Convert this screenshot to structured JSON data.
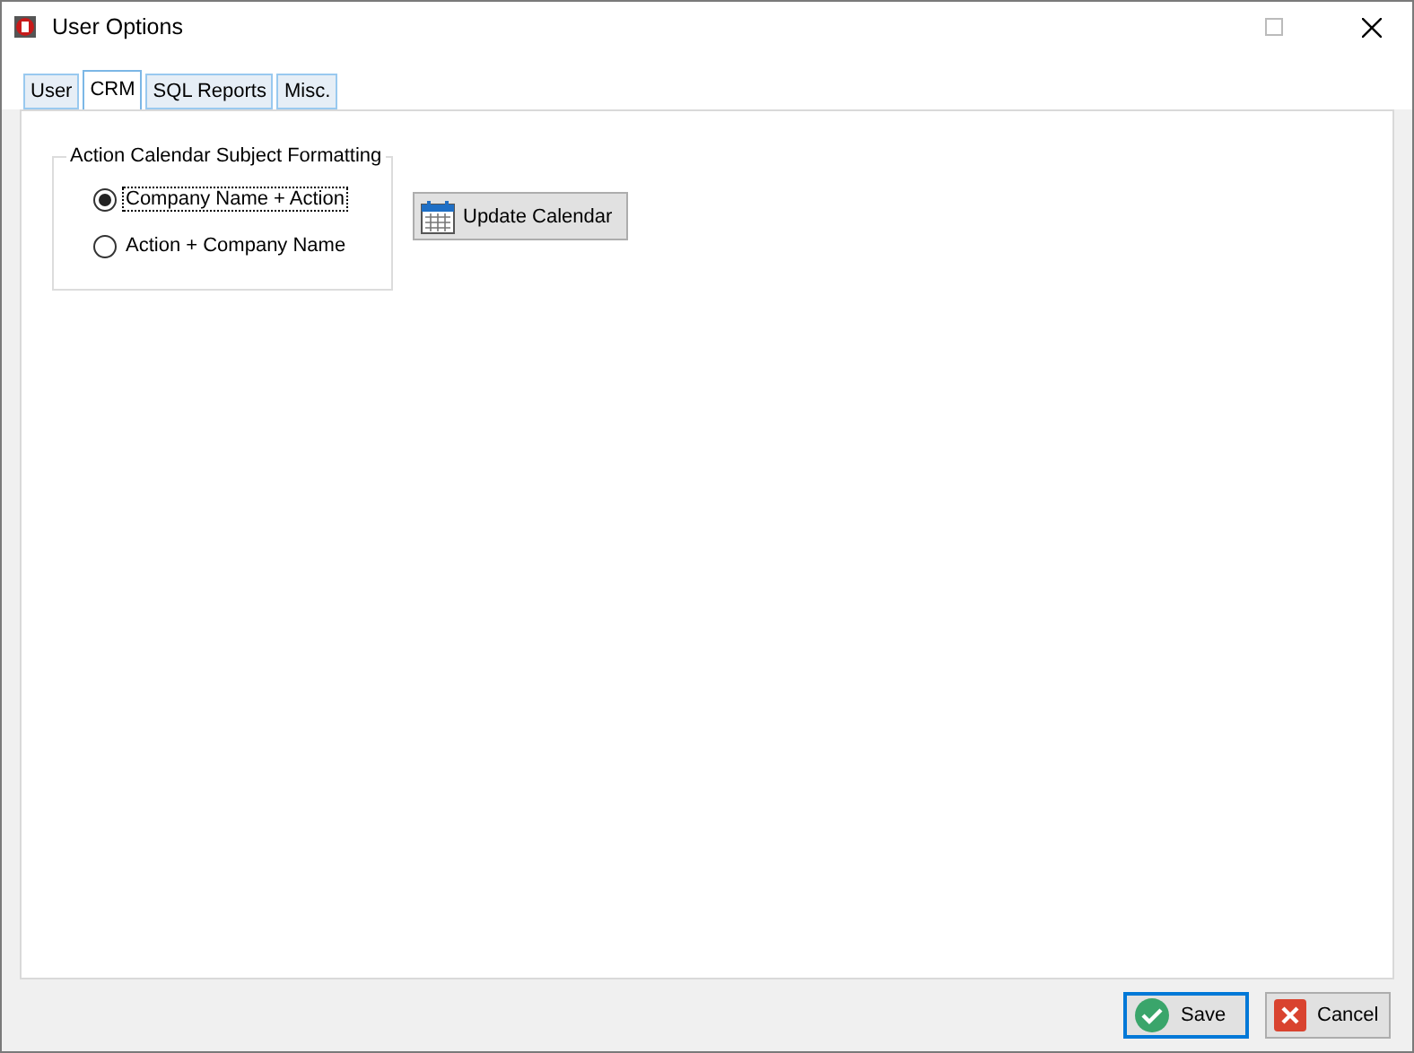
{
  "window": {
    "title": "User Options"
  },
  "tabs": [
    {
      "label": "User",
      "selected": false
    },
    {
      "label": "CRM",
      "selected": true
    },
    {
      "label": "SQL Reports",
      "selected": false
    },
    {
      "label": "Misc.",
      "selected": false
    }
  ],
  "group": {
    "title": "Action Calendar Subject Formatting",
    "options": [
      {
        "label": "Company Name + Action",
        "selected": true
      },
      {
        "label": "Action + Company Name",
        "selected": false
      }
    ]
  },
  "update_button": {
    "label": "Update Calendar"
  },
  "buttons": [
    {
      "label": "Save",
      "kind": "save",
      "focused": true
    },
    {
      "label": "Cancel",
      "kind": "cancel",
      "focused": false
    }
  ]
}
